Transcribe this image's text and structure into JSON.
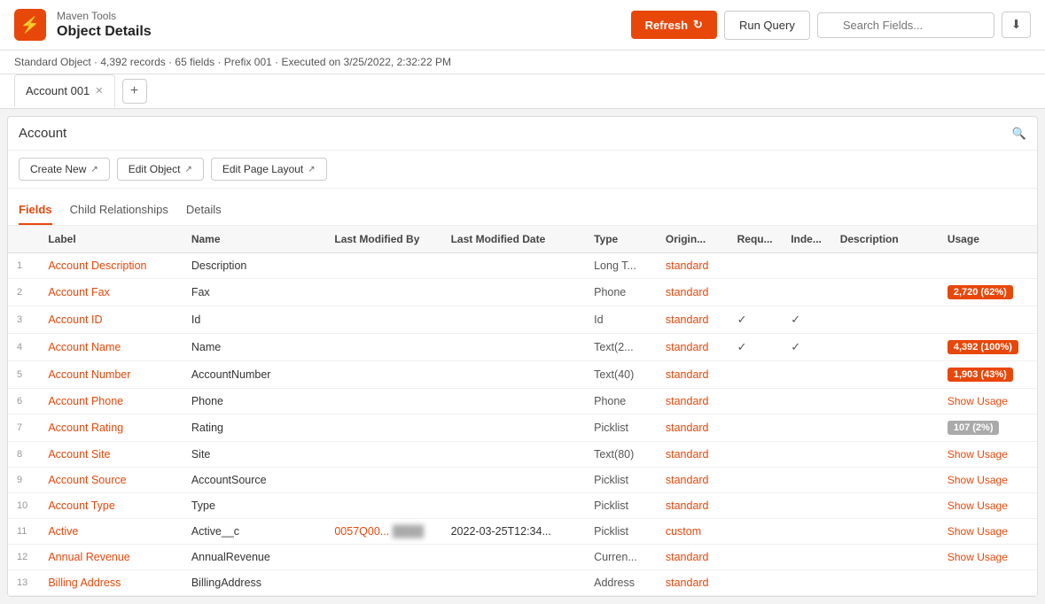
{
  "app": {
    "name": "Maven Tools",
    "title": "Object Details"
  },
  "header": {
    "refresh_label": "Refresh",
    "run_query_label": "Run Query",
    "search_placeholder": "Search Fields...",
    "subheader_text": "Standard Object · 4,392 records · 65 fields · Prefix 001 · Executed on 3/25/2022, 2:32:22 PM"
  },
  "tabs": [
    {
      "label": "Account 001",
      "active": true,
      "closeable": true
    }
  ],
  "object_input": {
    "value": "Account"
  },
  "action_buttons": [
    {
      "label": "Create New",
      "has_icon": true
    },
    {
      "label": "Edit Object",
      "has_icon": true
    },
    {
      "label": "Edit Page Layout",
      "has_icon": true
    }
  ],
  "nav_tabs": [
    {
      "label": "Fields",
      "active": true
    },
    {
      "label": "Child Relationships",
      "active": false
    },
    {
      "label": "Details",
      "active": false
    }
  ],
  "table": {
    "columns": [
      "",
      "Label",
      "Name",
      "Last Modified By",
      "Last Modified Date",
      "Type",
      "Origin...",
      "Requ...",
      "Inde...",
      "Description",
      "Usage"
    ],
    "rows": [
      {
        "num": "1",
        "label": "Account Description",
        "name": "Description",
        "modified_by": "",
        "modified_date": "",
        "type": "Long T...",
        "origin": "standard",
        "required": "",
        "indexed": "",
        "description": "",
        "usage": ""
      },
      {
        "num": "2",
        "label": "Account Fax",
        "name": "Fax",
        "modified_by": "",
        "modified_date": "",
        "type": "Phone",
        "origin": "standard",
        "required": "",
        "indexed": "",
        "description": "",
        "usage": "2,720 (62%)",
        "usage_type": "orange"
      },
      {
        "num": "3",
        "label": "Account ID",
        "name": "Id",
        "modified_by": "",
        "modified_date": "",
        "type": "Id",
        "origin": "standard",
        "required": "✓",
        "indexed": "✓",
        "description": "",
        "usage": ""
      },
      {
        "num": "4",
        "label": "Account Name",
        "name": "Name",
        "modified_by": "",
        "modified_date": "",
        "type": "Text(2...",
        "origin": "standard",
        "required": "✓",
        "indexed": "✓",
        "description": "",
        "usage": "4,392 (100%)",
        "usage_type": "orange"
      },
      {
        "num": "5",
        "label": "Account Number",
        "name": "AccountNumber",
        "modified_by": "",
        "modified_date": "",
        "type": "Text(40)",
        "origin": "standard",
        "required": "",
        "indexed": "",
        "description": "",
        "usage": "1,903 (43%)",
        "usage_type": "orange"
      },
      {
        "num": "6",
        "label": "Account Phone",
        "name": "Phone",
        "modified_by": "",
        "modified_date": "",
        "type": "Phone",
        "origin": "standard",
        "required": "",
        "indexed": "",
        "description": "",
        "usage": "Show Usage",
        "usage_type": "link"
      },
      {
        "num": "7",
        "label": "Account Rating",
        "name": "Rating",
        "modified_by": "",
        "modified_date": "",
        "type": "Picklist",
        "origin": "standard",
        "required": "",
        "indexed": "",
        "description": "",
        "usage": "107 (2%)",
        "usage_type": "gray"
      },
      {
        "num": "8",
        "label": "Account Site",
        "name": "Site",
        "modified_by": "",
        "modified_date": "",
        "type": "Text(80)",
        "origin": "standard",
        "required": "",
        "indexed": "",
        "description": "",
        "usage": "Show Usage",
        "usage_type": "link"
      },
      {
        "num": "9",
        "label": "Account Source",
        "name": "AccountSource",
        "modified_by": "",
        "modified_date": "",
        "type": "Picklist",
        "origin": "standard",
        "required": "",
        "indexed": "",
        "description": "",
        "usage": "Show Usage",
        "usage_type": "link"
      },
      {
        "num": "10",
        "label": "Account Type",
        "name": "Type",
        "modified_by": "",
        "modified_date": "",
        "type": "Picklist",
        "origin": "standard",
        "required": "",
        "indexed": "",
        "description": "",
        "usage": "Show Usage",
        "usage_type": "link"
      },
      {
        "num": "11",
        "label": "Active",
        "name": "Active__c",
        "modified_by": "0057Q00...",
        "modified_date": "2022-03-25T12:34...",
        "type": "Picklist",
        "origin": "custom",
        "required": "",
        "indexed": "",
        "description": "",
        "usage": "Show Usage",
        "usage_type": "link"
      },
      {
        "num": "12",
        "label": "Annual Revenue",
        "name": "AnnualRevenue",
        "modified_by": "",
        "modified_date": "",
        "type": "Curren...",
        "origin": "standard",
        "required": "",
        "indexed": "",
        "description": "",
        "usage": "Show Usage",
        "usage_type": "link"
      },
      {
        "num": "13",
        "label": "Billing Address",
        "name": "BillingAddress",
        "modified_by": "",
        "modified_date": "",
        "type": "Address",
        "origin": "standard",
        "required": "",
        "indexed": "",
        "description": "",
        "usage": ""
      }
    ]
  }
}
